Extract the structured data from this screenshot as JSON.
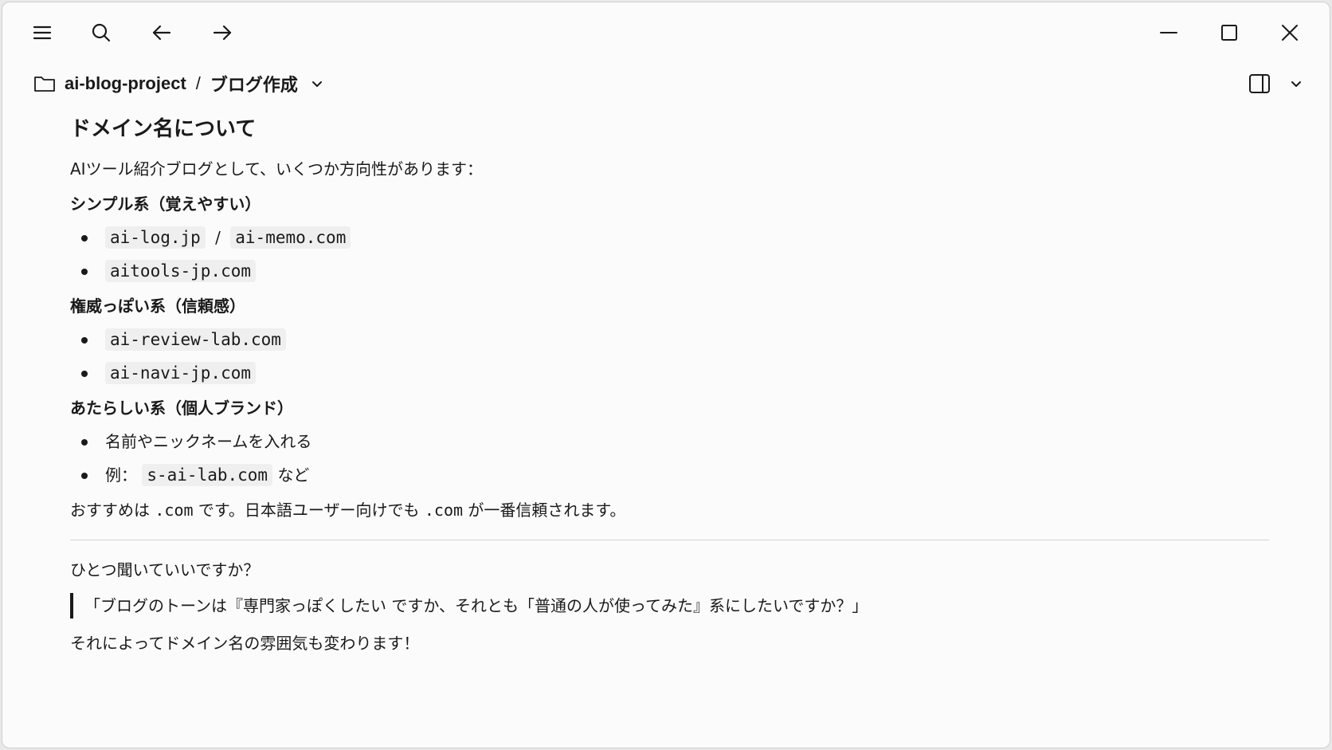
{
  "titlebar": {
    "icons": [
      "menu-icon",
      "search-icon",
      "back-arrow-icon",
      "forward-arrow-icon",
      "minimize-icon",
      "maximize-icon",
      "close-icon"
    ]
  },
  "breadcrumb": {
    "project": "ai-blog-project",
    "separator": "/",
    "page": "ブログ作成"
  },
  "article": {
    "heading": "ドメイン名について",
    "intro": "AIツール紹介ブログとして、いくつか方向性があります：",
    "sections": [
      {
        "title": "シンプル系（覚えやすい）",
        "items": [
          {
            "code1": "ai-log.jp",
            "mid": "/",
            "code2": "ai-memo.com"
          },
          {
            "code1": "aitools-jp.com"
          }
        ]
      },
      {
        "title": "権威っぽい系（信頼感）",
        "items": [
          {
            "code1": "ai-review-lab.com"
          },
          {
            "code1": "ai-navi-jp.com"
          }
        ]
      },
      {
        "title": "あたらしい系（個人ブランド）",
        "items": [
          {
            "text": "名前やニックネームを入れる"
          },
          {
            "prefix": "例：",
            "code1": "s-ai-lab.com",
            "suffix": "など"
          }
        ]
      }
    ],
    "recommend": {
      "part1": "おすすめは",
      "code1": ".com",
      "part2": "です。日本語ユーザー向けでも",
      "code2": ".com",
      "part3": "が一番信頼されます。"
    },
    "question": "ひとつ聞いていいですか？",
    "quote": "「ブログのトーンは『専門家っぽくしたい ですか、それとも「普通の人が使ってみた』系にしたいですか？」",
    "closing": "それによってドメイン名の雰囲気も変わります！"
  }
}
